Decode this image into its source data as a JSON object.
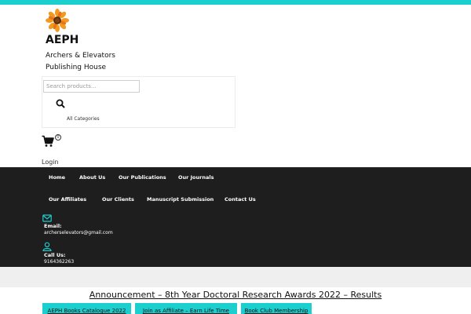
{
  "header": {
    "site_title": "AEPH",
    "tagline_line1": "Archers & Elevators",
    "tagline_line2": "Publishing House",
    "logo_icon": "sunflower-logo"
  },
  "search": {
    "placeholder": "Search products…",
    "value": "",
    "search_icon": "search-icon",
    "categories_label": "All Categories"
  },
  "cart": {
    "icon": "cart-icon",
    "count": "0"
  },
  "account": {
    "login_label": "Login"
  },
  "nav": {
    "items": [
      {
        "label": "Home"
      },
      {
        "label": "About Us"
      },
      {
        "label": "Our Publications"
      },
      {
        "label": "Our Journals"
      },
      {
        "label": "Our Affiliates"
      },
      {
        "label": "Our Clients"
      },
      {
        "label": "Manuscript Submission"
      },
      {
        "label": "Contact Us"
      }
    ]
  },
  "contact": {
    "email_label": "Email:",
    "email_value": "archerselevators@gmail.com",
    "call_label": "Call Us:",
    "call_value": "9164362263"
  },
  "main": {
    "announcement": "Announcement – 8th Year Doctoral Research Awards 2022 – Results",
    "buttons": [
      {
        "label": "AEPH Books Catalogue 2022"
      },
      {
        "label": "Join as Affiliate – Earn Life Time"
      },
      {
        "label": "Book Club Membership"
      }
    ]
  },
  "colors": {
    "accent": "#1ccfcf",
    "nav_background": "#1e1e1e",
    "band_background": "#efefef"
  }
}
